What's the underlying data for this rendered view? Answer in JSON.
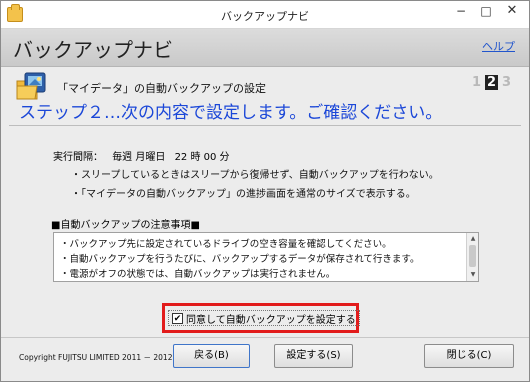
{
  "window": {
    "title": "バックアップナビ",
    "minimize": "−",
    "maximize": "□",
    "close": "✕"
  },
  "header": {
    "title": "バックアップナビ",
    "help": "ヘルプ"
  },
  "step": {
    "subtitle": "「マイデータ」の自動バックアップの設定",
    "indicators": [
      "1",
      "2",
      "3"
    ],
    "current": "2",
    "heading": "ステップ２…次の内容で設定します。ご確認ください。"
  },
  "settings": {
    "schedule_label": "実行間隔：",
    "schedule_freq": "毎週 月曜日",
    "schedule_time": "22 時 00 分",
    "bullets": [
      "・スリープしているときはスリープから復帰せず、自動バックアップを行わない。",
      "・「マイデータの自動バックアップ」の進捗画面を通常のサイズで表示する。"
    ]
  },
  "notes": {
    "title": "■自動バックアップの注意事項■",
    "lines": [
      "・バックアップ先に設定されているドライブの空き容量を確認してください。",
      "・自動バックアップを行うたびに、バックアップするデータが保存されて行きます。",
      "・電源がオフの状態では、自動バックアップは実行されません。"
    ]
  },
  "agree": {
    "checked": true,
    "label": "同意して自動バックアップを設定する"
  },
  "footer": {
    "copyright": "Copyright FUJITSU LIMITED 2011 － 2012",
    "back": "戻る(B)",
    "set": "設定する(S)",
    "close": "閉じる(C)"
  },
  "colors": {
    "heading": "#1b47d8",
    "highlight": "#e21b1b",
    "link": "#2255cc"
  }
}
